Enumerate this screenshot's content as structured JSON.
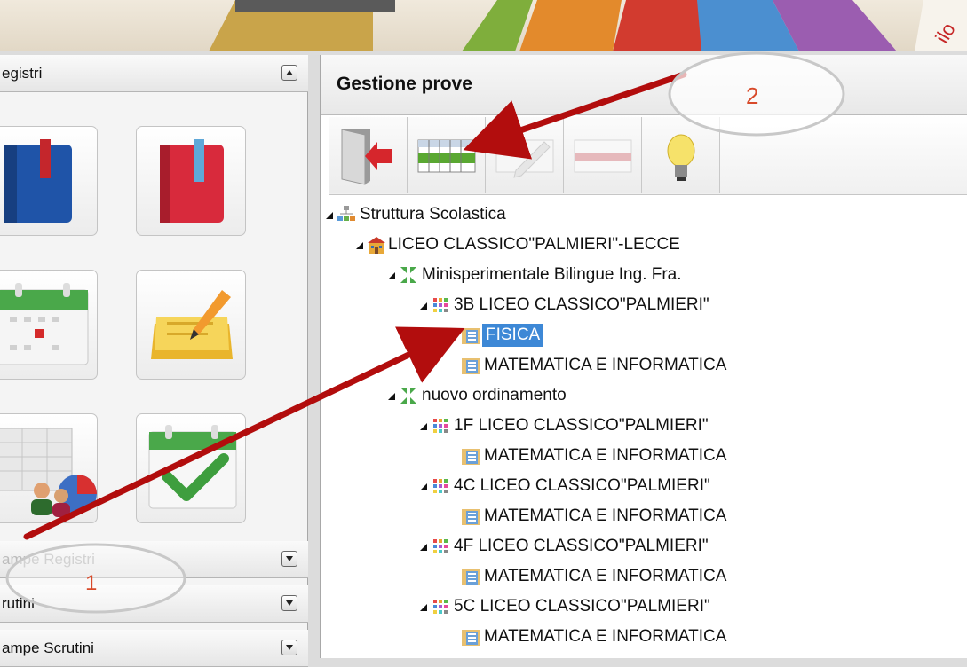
{
  "left_panel": {
    "registri_header": "egistri",
    "stampe_registri_header": "ampe Registri",
    "scrutini_header": "rutini",
    "stampe_scrutini_header": "ampe Scrutini"
  },
  "main_panel": {
    "title": "Gestione prove",
    "toolbar": [
      "exit-icon",
      "grid-icon",
      "pencil-icon",
      "minus-grid-icon",
      "lightbulb-icon"
    ]
  },
  "tree": {
    "root": "Struttura Scolastica",
    "school": "LICEO CLASSICO\"PALMIERI\"-LECCE",
    "course1": "Minisperimentale Bilingue Ing. Fra.",
    "class_3b": "3B LICEO CLASSICO\"PALMIERI\"",
    "subj_fisica": "FISICA",
    "subj_mat1": "MATEMATICA E INFORMATICA",
    "course2": "nuovo ordinamento",
    "class_1f": "1F LICEO CLASSICO\"PALMIERI\"",
    "subj_mat2": "MATEMATICA E INFORMATICA",
    "class_4c": "4C LICEO CLASSICO\"PALMIERI\"",
    "subj_mat3": "MATEMATICA E INFORMATICA",
    "class_4f": "4F LICEO CLASSICO\"PALMIERI\"",
    "subj_mat4": "MATEMATICA E INFORMATICA",
    "class_5c": "5C LICEO CLASSICO\"PALMIERI\"",
    "subj_mat5": "MATEMATICA E INFORMATICA"
  },
  "annotations": {
    "callout_1": "1",
    "callout_2": "2",
    "arrow_color": "#b20d0d"
  }
}
